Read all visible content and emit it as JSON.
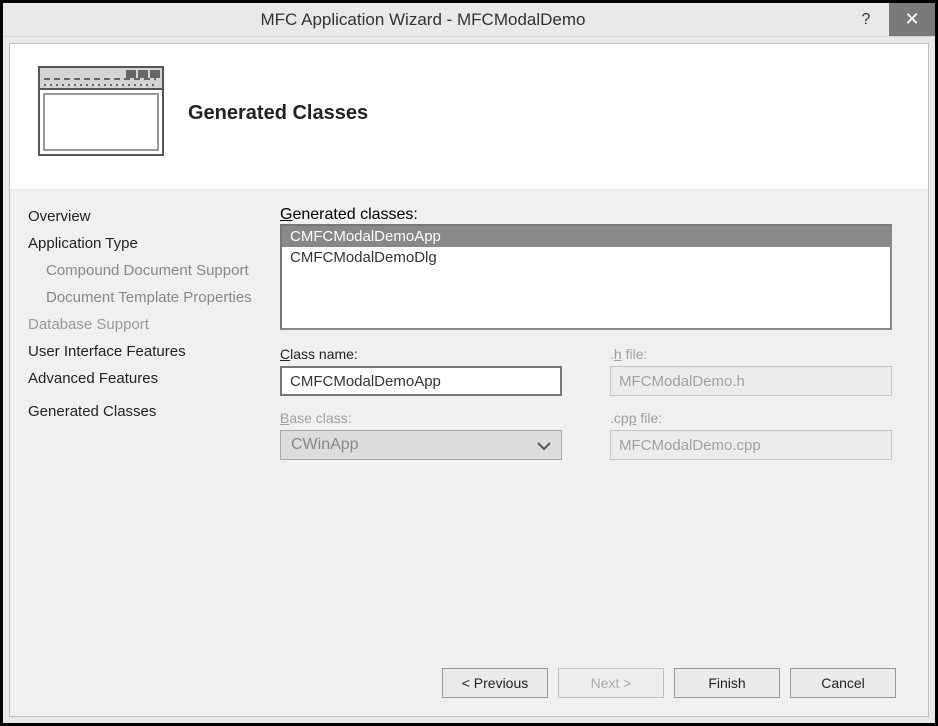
{
  "window": {
    "title": "MFC Application Wizard - MFCModalDemo"
  },
  "header": {
    "title": "Generated Classes"
  },
  "sidebar": {
    "items": [
      {
        "label": "Overview",
        "kind": "top"
      },
      {
        "label": "Application Type",
        "kind": "top"
      },
      {
        "label": "Compound Document Support",
        "kind": "sub"
      },
      {
        "label": "Document Template Properties",
        "kind": "sub"
      },
      {
        "label": "Database Support",
        "kind": "dim"
      },
      {
        "label": "User Interface Features",
        "kind": "top"
      },
      {
        "label": "Advanced Features",
        "kind": "top"
      },
      {
        "label": "Generated Classes",
        "kind": "current"
      }
    ]
  },
  "main": {
    "generated_classes_label": "Generated classes:",
    "classes": [
      {
        "name": "CMFCModalDemoApp",
        "selected": true
      },
      {
        "name": "CMFCModalDemoDlg",
        "selected": false
      }
    ],
    "class_name_label": "Class name:",
    "class_name_value": "CMFCModalDemoApp",
    "h_file_label": ".h file:",
    "h_file_value": "MFCModalDemo.h",
    "base_class_label": "Base class:",
    "base_class_value": "CWinApp",
    "cpp_file_label": ".cpp file:",
    "cpp_file_value": "MFCModalDemo.cpp"
  },
  "footer": {
    "previous": "< Previous",
    "next": "Next >",
    "finish": "Finish",
    "cancel": "Cancel"
  }
}
